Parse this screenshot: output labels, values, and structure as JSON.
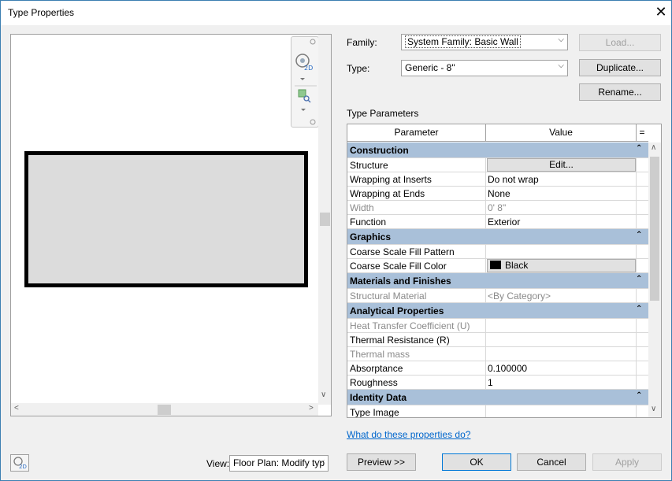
{
  "window": {
    "title": "Type Properties",
    "close_glyph": "✕"
  },
  "preview": {
    "view_label": "View:",
    "view_value": "Floor Plan: Modify typ"
  },
  "family": {
    "label": "Family:",
    "value": "System Family: Basic Wall"
  },
  "type": {
    "label": "Type:",
    "value": "Generic - 8\""
  },
  "buttons": {
    "load": "Load...",
    "duplicate": "Duplicate...",
    "rename": "Rename...",
    "preview": "Preview >>",
    "ok": "OK",
    "cancel": "Cancel",
    "apply": "Apply"
  },
  "type_parameters_label": "Type Parameters",
  "grid": {
    "col_parameter": "Parameter",
    "col_value": "Value",
    "col_extra": "=",
    "categories": [
      {
        "name": "Construction",
        "rows": [
          {
            "param": "Structure",
            "value": "Edit...",
            "kind": "button"
          },
          {
            "param": "Wrapping at Inserts",
            "value": "Do not wrap"
          },
          {
            "param": "Wrapping at Ends",
            "value": "None"
          },
          {
            "param": "Width",
            "value": "0'  8\"",
            "grey": true
          },
          {
            "param": "Function",
            "value": "Exterior"
          }
        ]
      },
      {
        "name": "Graphics",
        "rows": [
          {
            "param": "Coarse Scale Fill Pattern",
            "value": ""
          },
          {
            "param": "Coarse Scale Fill Color",
            "value": "Black",
            "kind": "color"
          }
        ]
      },
      {
        "name": "Materials and Finishes",
        "rows": [
          {
            "param": "Structural Material",
            "value": "<By Category>",
            "grey": true
          }
        ]
      },
      {
        "name": "Analytical Properties",
        "rows": [
          {
            "param": "Heat Transfer Coefficient (U)",
            "value": "",
            "grey": true
          },
          {
            "param": "Thermal Resistance (R)",
            "value": ""
          },
          {
            "param": "Thermal mass",
            "value": "",
            "grey": true
          },
          {
            "param": "Absorptance",
            "value": "0.100000"
          },
          {
            "param": "Roughness",
            "value": "1"
          }
        ]
      },
      {
        "name": "Identity Data",
        "rows": [
          {
            "param": "Type Image",
            "value": ""
          }
        ]
      }
    ]
  },
  "help_link": "What do these properties do?",
  "colors": {
    "category_bg": "#a9c0d9",
    "link": "#0066cc",
    "accent": "#0078d7"
  },
  "icons": [
    "close-icon",
    "navigation-wheel-icon",
    "zoom-region-icon",
    "chevron-down-icon",
    "collapse-icon",
    "2d-view-icon"
  ]
}
